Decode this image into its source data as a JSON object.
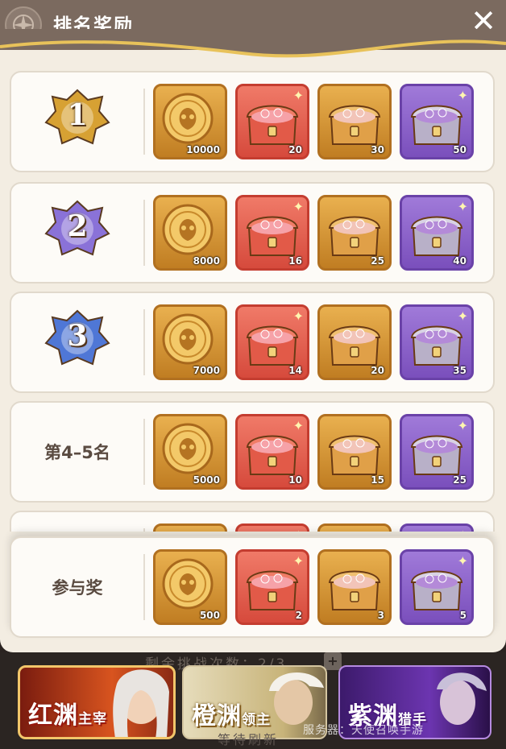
{
  "header": {
    "title": "排名奖励",
    "close_icon": "close-icon"
  },
  "rows": [
    {
      "label": "",
      "badge": "rank-1-badge",
      "numeral": "1",
      "badge_color": "#d7a133",
      "items": [
        {
          "type": "gold-coin-icon",
          "color": "gold",
          "qty": "10000"
        },
        {
          "type": "red-chest-icon",
          "color": "red",
          "qty": "20"
        },
        {
          "type": "orange-chest-icon",
          "color": "gold",
          "qty": "30"
        },
        {
          "type": "purple-chest-icon",
          "color": "purple",
          "qty": "50"
        }
      ]
    },
    {
      "label": "",
      "badge": "rank-2-badge",
      "numeral": "2",
      "badge_color": "#8a72d8",
      "items": [
        {
          "type": "gold-coin-icon",
          "color": "gold",
          "qty": "8000"
        },
        {
          "type": "red-chest-icon",
          "color": "red",
          "qty": "16"
        },
        {
          "type": "orange-chest-icon",
          "color": "gold",
          "qty": "25"
        },
        {
          "type": "purple-chest-icon",
          "color": "purple",
          "qty": "40"
        }
      ]
    },
    {
      "label": "",
      "badge": "rank-3-badge",
      "numeral": "3",
      "badge_color": "#4f77d6",
      "items": [
        {
          "type": "gold-coin-icon",
          "color": "gold",
          "qty": "7000"
        },
        {
          "type": "red-chest-icon",
          "color": "red",
          "qty": "14"
        },
        {
          "type": "orange-chest-icon",
          "color": "gold",
          "qty": "20"
        },
        {
          "type": "purple-chest-icon",
          "color": "purple",
          "qty": "35"
        }
      ]
    },
    {
      "label": "第4–5名",
      "badge": "",
      "items": [
        {
          "type": "gold-coin-icon",
          "color": "gold",
          "qty": "5000"
        },
        {
          "type": "red-chest-icon",
          "color": "red",
          "qty": "10"
        },
        {
          "type": "orange-chest-icon",
          "color": "gold",
          "qty": "15"
        },
        {
          "type": "purple-chest-icon",
          "color": "purple",
          "qty": "25"
        }
      ]
    },
    {
      "label": "",
      "badge": "",
      "items": [
        {
          "type": "gold-coin-icon",
          "color": "gold",
          "qty": ""
        },
        {
          "type": "red-chest-icon",
          "color": "red",
          "qty": ""
        },
        {
          "type": "orange-chest-icon",
          "color": "gold",
          "qty": ""
        },
        {
          "type": "purple-chest-icon",
          "color": "purple",
          "qty": ""
        }
      ]
    }
  ],
  "participation": {
    "label": "参与奖",
    "items": [
      {
        "type": "gold-coin-icon",
        "color": "gold",
        "qty": "500"
      },
      {
        "type": "red-chest-icon",
        "color": "red",
        "qty": "2"
      },
      {
        "type": "orange-chest-icon",
        "color": "gold",
        "qty": "3"
      },
      {
        "type": "purple-chest-icon",
        "color": "purple",
        "qty": "5"
      }
    ]
  },
  "background": {
    "remaining_text": "剩余挑战次数：2/3",
    "plus_label": "+",
    "bottom_text": "等待刷新"
  },
  "banners": [
    {
      "name": "红渊",
      "sub": "主宰",
      "color": "#d8541f"
    },
    {
      "name": "橙渊",
      "sub": "领主",
      "color": "#c8b47a"
    },
    {
      "name": "紫渊",
      "sub": "猎手",
      "color": "#6c35b0"
    }
  ],
  "watermark": "服务器：天使召唤手游"
}
